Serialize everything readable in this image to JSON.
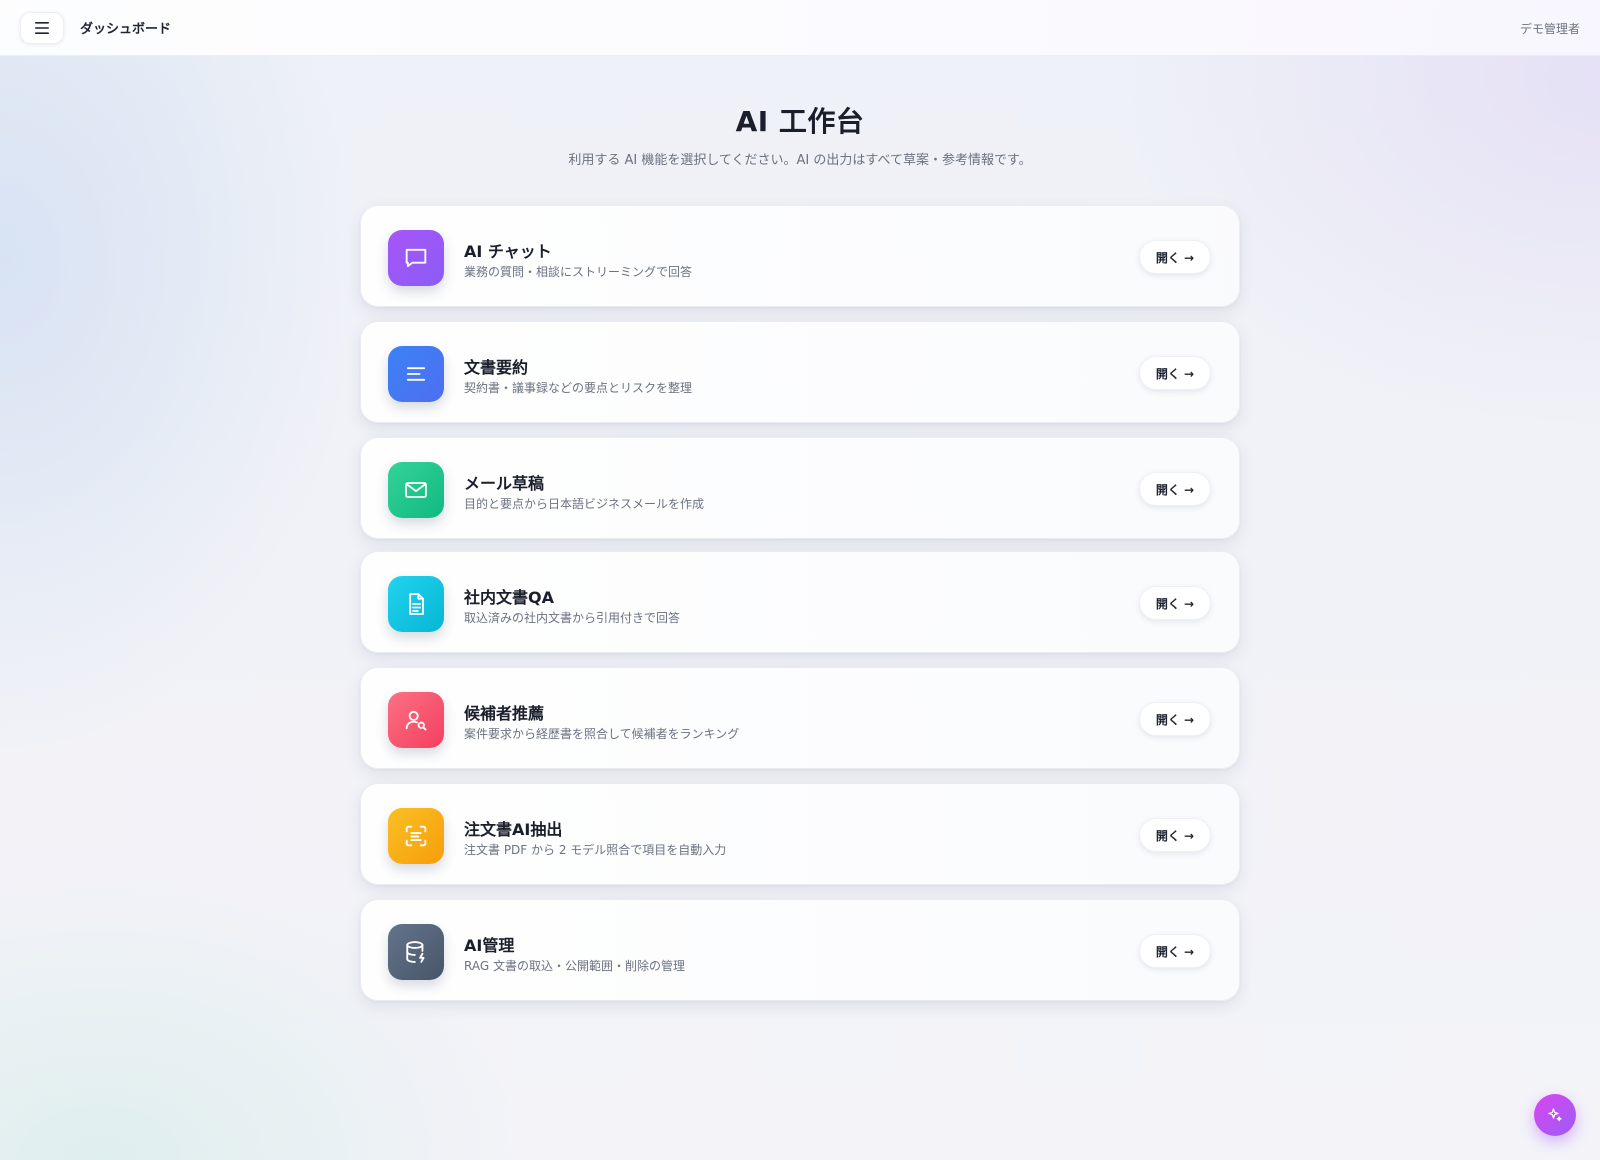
{
  "topbar": {
    "menu_icon": "hamburger-menu-icon",
    "title": "ダッシュボード",
    "user": "デモ管理者"
  },
  "page": {
    "title": "AI 工作台",
    "subtitle": "利用する AI 機能を選択してください。AI の出力はすべて草案・参考情報です。"
  },
  "cards": [
    {
      "title": "AI チャット",
      "desc": "業務の質問・相談にストリーミングで回答",
      "button": "開く →",
      "icon": "chat-bubble-icon",
      "color_from": "#a855f7",
      "color_to": "#8b5cf6"
    },
    {
      "title": "文書要約",
      "desc": "契約書・議事録などの要点とリスクを整理",
      "button": "開く →",
      "icon": "lines-icon",
      "color_from": "#3b82f6",
      "color_to": "#4f6ef0"
    },
    {
      "title": "メール草稿",
      "desc": "目的と要点から日本語ビジネスメールを作成",
      "button": "開く →",
      "icon": "mail-icon",
      "color_from": "#34d399",
      "color_to": "#10b981"
    },
    {
      "title": "社内文書QA",
      "desc": "取込済みの社内文書から引用付きで回答",
      "button": "開く →",
      "icon": "document-icon",
      "color_from": "#22d3ee",
      "color_to": "#06b6d4"
    },
    {
      "title": "候補者推薦",
      "desc": "案件要求から経歴書を照合して候補者をランキング",
      "button": "開く →",
      "icon": "user-search-icon",
      "color_from": "#fb7185",
      "color_to": "#f43f5e"
    },
    {
      "title": "注文書AI抽出",
      "desc": "注文書 PDF から 2 モデル照合で項目を自動入力",
      "button": "開く →",
      "icon": "scan-text-icon",
      "color_from": "#fbbf24",
      "color_to": "#f59e0b"
    },
    {
      "title": "AI管理",
      "desc": "RAG 文書の取込・公開範囲・削除の管理",
      "button": "開く →",
      "icon": "database-bolt-icon",
      "color_from": "#64748b",
      "color_to": "#475569"
    }
  ],
  "fab": {
    "icon": "sparkle-icon"
  }
}
